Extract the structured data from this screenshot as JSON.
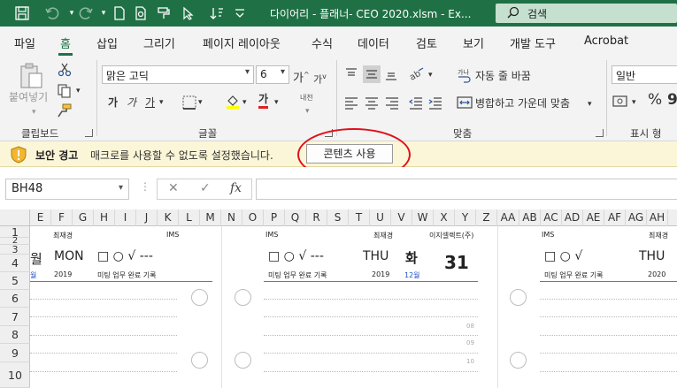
{
  "titlebar": {
    "title": "다이어리 - 플래너- CEO 2020.xlsm  -  Ex...",
    "search_placeholder": "검색"
  },
  "menu": {
    "tabs": [
      "파일",
      "홈",
      "삽입",
      "그리기",
      "페이지 레이아웃",
      "수식",
      "데이터",
      "검토",
      "보기",
      "개발 도구",
      "Acrobat"
    ],
    "active": "홈"
  },
  "ribbon": {
    "clipboard": {
      "paste_label": "붙여넣기",
      "group_label": "클립보드"
    },
    "font": {
      "font_name": "맑은 고딕",
      "font_size": "6",
      "grow": "가",
      "shrink": "가",
      "bold": "가",
      "italic": "가",
      "underline": "가",
      "color_letter": "가",
      "phonetic": "내천",
      "group_label": "글꼴"
    },
    "alignment": {
      "wrap_text": "자동 줄 바꿈",
      "merge_center": "병합하고 가운데 맞춤",
      "group_label": "맞춤"
    },
    "number": {
      "format": "일반",
      "percent": "%",
      "comma": "9",
      "group_label": "표시 형"
    }
  },
  "security_bar": {
    "title": "보안 경고",
    "message": "매크로를 사용할 수 없도록 설정했습니다.",
    "button_label": "콘텐츠 사용"
  },
  "formula_bar": {
    "name_box": "BH48",
    "fx": "fx",
    "value": ""
  },
  "sheet": {
    "columns": [
      "E",
      "F",
      "G",
      "H",
      "I",
      "J",
      "K",
      "L",
      "M",
      "N",
      "O",
      "P",
      "Q",
      "R",
      "S",
      "T",
      "U",
      "V",
      "W",
      "X",
      "Y",
      "Z",
      "AA",
      "AB",
      "AC",
      "AD",
      "AE",
      "AF",
      "AG",
      "AH"
    ],
    "rows": [
      "1",
      "2",
      "3",
      "4",
      "5",
      "6",
      "7",
      "8",
      "9",
      "10"
    ],
    "cells": {
      "p1_author": "최재경",
      "p1_ims": "IMS",
      "p1_day_big": "월",
      "p1_dow": "MON",
      "p1_symbols": "□  ○  √  ---",
      "p1_year": "2019",
      "p1_month": "월",
      "p1_tags": "미팅  업무  완료  기록",
      "p2_ims": "IMS",
      "p2_author": "최재경",
      "p2_company": "이지셀렉트(주)",
      "p2_symbols": "□  ○  √  ---",
      "p2_dow": "THU",
      "p2_weekday": "화",
      "p2_date": "31",
      "p2_tags": "미팅  업무  완료  기록",
      "p2_year": "2019",
      "p2_month": "12월",
      "p2_hour_08": "08",
      "p2_hour_09": "09",
      "p2_hour_10": "10",
      "p3_ims": "IMS",
      "p3_author": "최재경",
      "p3_symbols": "□  ○  √",
      "p3_dow": "THU",
      "p3_tags": "미팅  업무  완료  기록",
      "p3_year": "2020"
    }
  },
  "colors": {
    "title_green": "#1f7145",
    "security_bg": "#fcf6d8",
    "annotation_red": "#e0101a",
    "month_blue": "#1f4fc8"
  }
}
